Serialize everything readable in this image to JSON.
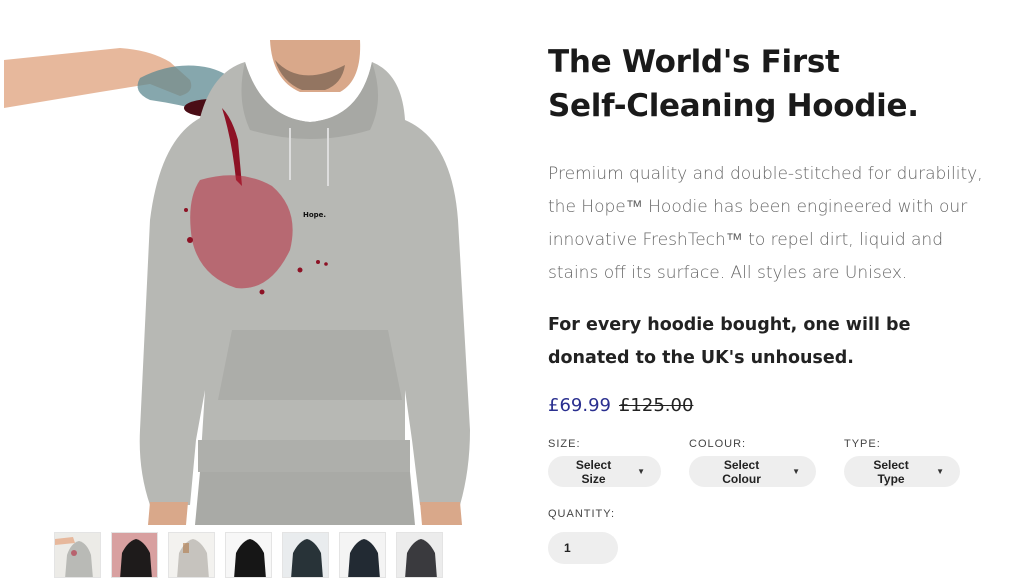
{
  "product": {
    "title_line1": "The World's First",
    "title_line2": "Self-Cleaning Hoodie.",
    "description": "Premium quality and double-stitched for durability, the Hope™ Hoodie has been engineered with our innovative FreshTech™ to repel dirt, liquid and stains off its surface. All styles are Unisex.",
    "charity": "For every hoodie bought, one will be donated to the UK's unhoused.",
    "price_current": "£69.99",
    "price_old": "£125.00",
    "chest_print": "Hope."
  },
  "options": {
    "size": {
      "label": "SIZE:",
      "value": "Select Size"
    },
    "colour": {
      "label": "COLOUR:",
      "value": "Select Colour"
    },
    "type": {
      "label": "TYPE:",
      "value": "Select Type"
    }
  },
  "quantity": {
    "label": "QUANTITY:",
    "value": "1"
  },
  "thumbnails": [
    {
      "name": "grey-wine",
      "color": "#b9bab6"
    },
    {
      "name": "black-red",
      "color": "#1e1b1b"
    },
    {
      "name": "grey-stain",
      "color": "#c6c3be"
    },
    {
      "name": "black",
      "color": "#161616"
    },
    {
      "name": "dark-teal",
      "color": "#283338"
    },
    {
      "name": "navy",
      "color": "#222a33"
    },
    {
      "name": "charcoal",
      "color": "#3a3a3e"
    }
  ],
  "colors": {
    "accent_price": "#2a2f8f",
    "hoodie_grey": "#b7b8b4",
    "wine": "#8d1225"
  }
}
